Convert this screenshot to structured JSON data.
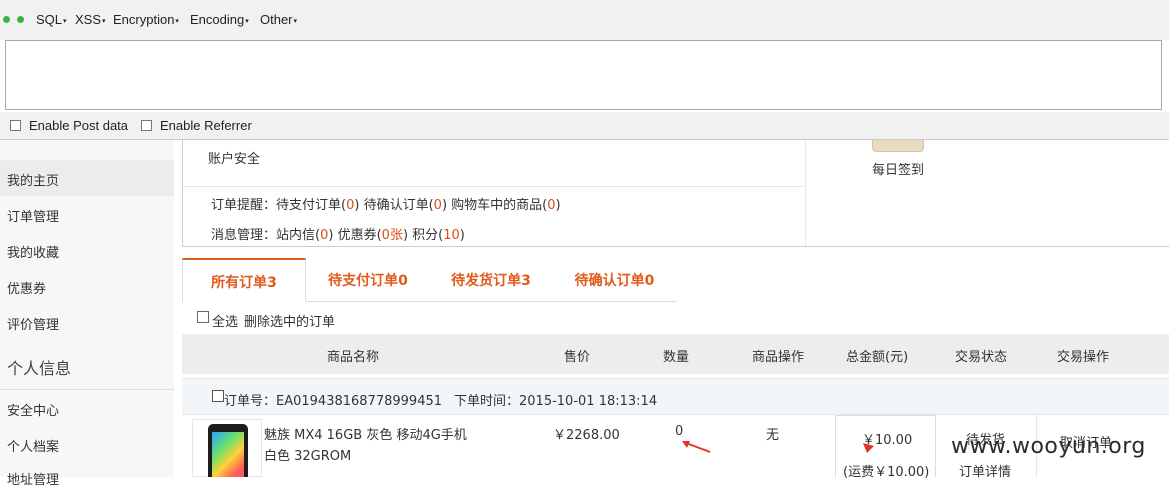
{
  "hackbar": {
    "menus": [
      {
        "label": "SQL"
      },
      {
        "label": "XSS"
      },
      {
        "label": "Encryption"
      },
      {
        "label": "Encoding"
      },
      {
        "label": "Other"
      }
    ],
    "url_value": "",
    "enable_post_label": "Enable Post data",
    "enable_referrer_label": "Enable Referrer"
  },
  "sidebar": {
    "items_top": [
      {
        "label": "我的主页"
      },
      {
        "label": "订单管理"
      },
      {
        "label": "我的收藏"
      },
      {
        "label": "优惠券"
      },
      {
        "label": "评价管理"
      }
    ],
    "section_title": "个人信息",
    "items_bottom": [
      {
        "label": "安全中心"
      },
      {
        "label": "个人档案"
      },
      {
        "label": "地址管理"
      }
    ]
  },
  "info": {
    "account_security": "账户安全",
    "order_reminder_label": "订单提醒：",
    "pending_payment_label": "待支付订单(",
    "pending_payment_count": "0",
    "pending_confirm_label": "待确认订单(",
    "pending_confirm_count": "0",
    "cart_label": "购物车中的商品(",
    "cart_count": "0",
    "message_mgmt_label": "消息管理：",
    "inbox_label": "站内信(",
    "inbox_count": "0",
    "coupon_label": "优惠券(",
    "coupon_count": "0张",
    "points_label": "积分(",
    "points_count": "10",
    "close_paren": ")",
    "daily_checkin": "每日签到"
  },
  "tabs": [
    {
      "label": "所有订单3"
    },
    {
      "label": "待支付订单0"
    },
    {
      "label": "待发货订单3"
    },
    {
      "label": "待确认订单0"
    }
  ],
  "select_all": {
    "label": "全选",
    "delete_label": "删除选中的订单"
  },
  "table_headers": {
    "product_name": "商品名称",
    "price": "售价",
    "quantity": "数量",
    "product_op": "商品操作",
    "total": "总金额(元)",
    "status": "交易状态",
    "trade_op": "交易操作"
  },
  "order": {
    "order_no_label": "订单号：",
    "order_no": "EA019438168778999451",
    "order_time_label": "下单时间：",
    "order_time": "2015-10-01 18:13:14",
    "product_name_line1": "魅族 MX4 16GB 灰色 移动4G手机",
    "product_name_line2": "白色 32GROM",
    "price": "￥2268.00",
    "quantity": "0",
    "product_op": "无",
    "total": "￥10.00",
    "shipping": "(运费￥10.00)",
    "status": "待发货",
    "details_link": "订单详情",
    "cancel_link": "取消订单"
  },
  "watermark": "www.wooyun.org",
  "colors": {
    "accent": "#e05a1b",
    "green_dot": "#3cb43c",
    "arrow_red": "#e0342a"
  }
}
